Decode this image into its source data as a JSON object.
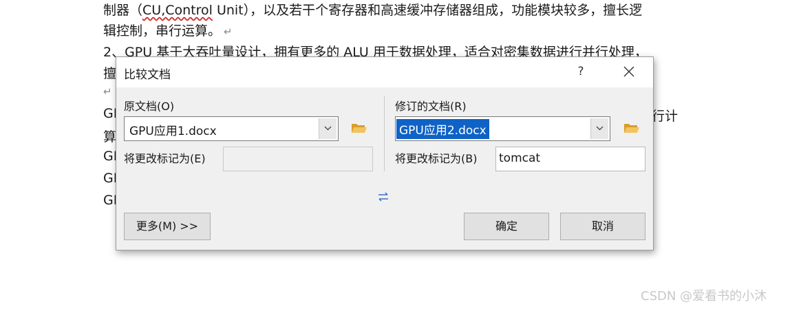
{
  "document": {
    "line1_pre": "制器（",
    "line1_underlined": "CU,Control",
    "line1_post": " Unit），以及若干个寄存器和高速缓冲存储器组成，功能模块较多，擅长逻",
    "line2": "辑控制，串行运算。",
    "line3": "2、GPU 基于大吞吐量设计，拥有更多的 ALU 用于数据处理，适合对密集数据进行并行处理，",
    "line4": "擅",
    "line6": "GI",
    "line6_right": "行计",
    "line7": "算",
    "line8": "GI",
    "line9": "GI",
    "line10": "GI",
    "return_mark": "↵"
  },
  "watermark": "CSDN @爱看书的小沐",
  "dialog": {
    "title": "比较文档",
    "help_label": "?",
    "original": {
      "label": "原文档(O)",
      "value": "GPU应用1.docx",
      "mark_label": "将更改标记为(E)",
      "mark_value": ""
    },
    "revised": {
      "label": "修订的文档(R)",
      "value": "GPU应用2.docx",
      "mark_label": "将更改标记为(B)",
      "mark_value": "tomcat"
    },
    "more_button": "更多(M) >>",
    "ok_button": "确定",
    "cancel_button": "取消"
  },
  "colors": {
    "selection": "#0f62c6",
    "folder": "#e8b24a",
    "swap_arrow": "#3a6fc4"
  }
}
